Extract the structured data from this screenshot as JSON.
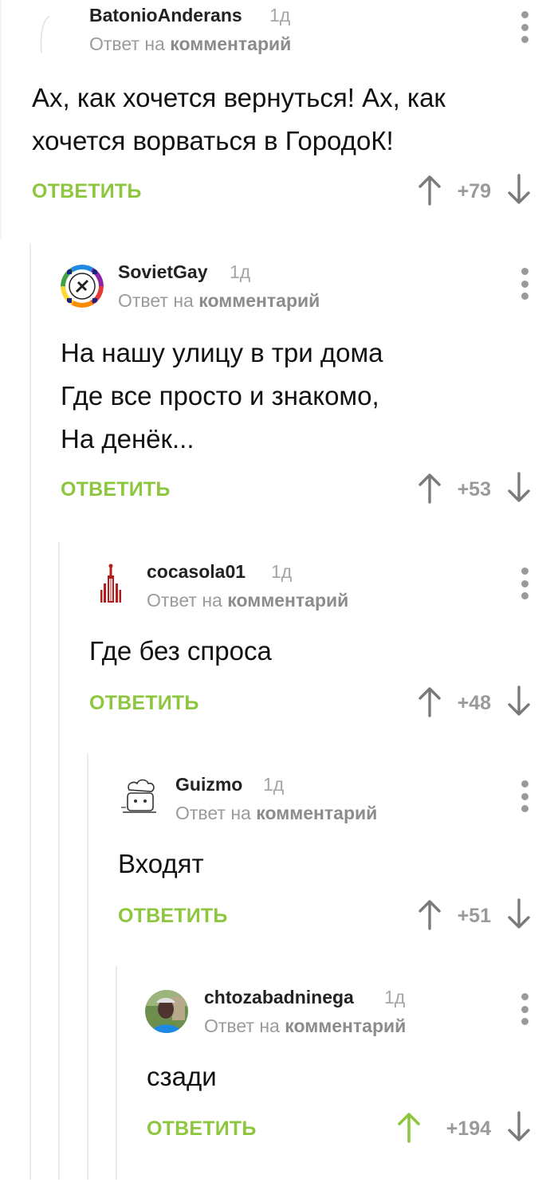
{
  "comments": [
    {
      "author": "BatonioAnderans",
      "time": "1д",
      "reply_prefix": "Ответ на",
      "reply_target": "комментарий",
      "text": "Ах, как хочется вернуться! Ах, как\nхочется ворваться в ГородоК!",
      "reply_label": "ОТВЕТИТЬ",
      "rating": "+79",
      "upvoted": false,
      "avatar": "empty-avatar"
    },
    {
      "author": "SovietGay",
      "time": "1д",
      "reply_prefix": "Ответ на",
      "reply_target": "комментарий",
      "text": "На нашу улицу в три дома\nГде все просто и знакомо,\nНа денёк...",
      "reply_label": "ОТВЕТИТЬ",
      "rating": "+53",
      "upvoted": false,
      "avatar": "rainbow-emblem-avatar"
    },
    {
      "author": "cocasola01",
      "time": "1д",
      "reply_prefix": "Ответ на",
      "reply_target": "комментарий",
      "text": "Где без спроса",
      "reply_label": "ОТВЕТИТЬ",
      "rating": "+48",
      "upvoted": false,
      "avatar": "red-tower-avatar"
    },
    {
      "author": "Guizmo",
      "time": "1д",
      "reply_prefix": "Ответ на",
      "reply_target": "комментарий",
      "text": "Входят",
      "reply_label": "ОТВЕТИТЬ",
      "rating": "+51",
      "upvoted": false,
      "avatar": "toaster-chef-avatar"
    },
    {
      "author": "chtozabadninega",
      "time": "1д",
      "reply_prefix": "Ответ на",
      "reply_target": "комментарий",
      "text": "сзади",
      "reply_label": "ОТВЕТИТЬ",
      "rating": "+194",
      "upvoted": true,
      "avatar": "photo-avatar"
    }
  ],
  "colors": {
    "accent_green": "#8dc63f",
    "muted_gray": "#9a9a9a",
    "thread_line": "#ececec"
  },
  "icons": [
    "upvote-arrow-icon",
    "downvote-arrow-icon",
    "more-menu-icon"
  ]
}
